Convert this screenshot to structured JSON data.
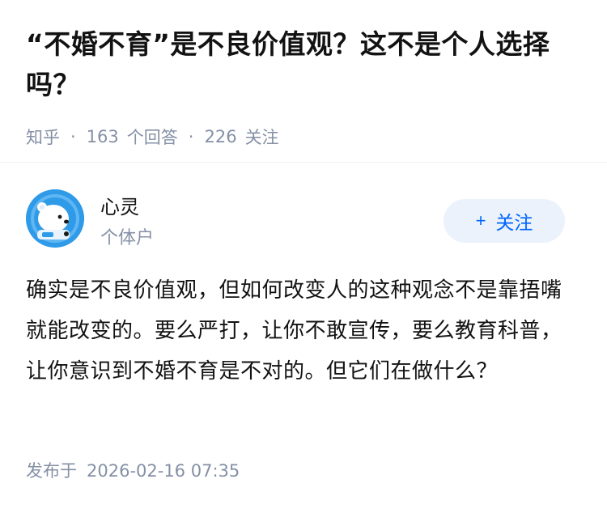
{
  "question": {
    "title": "“不婚不育”是不良价值观？这不是个人选择吗？",
    "source": "知乎",
    "answer_count": "163",
    "answer_label": "个回答",
    "follower_count": "226",
    "follower_label": "关注"
  },
  "author": {
    "name": "心灵",
    "tag": "个体户",
    "avatar_icon": "polar-bear-avatar-icon",
    "follow_label": "关注",
    "follow_icon": "plus-icon"
  },
  "answer": {
    "text": "确实是不良价值观，但如何改变人的这种观念不是靠捂嘴就能改变的。要么严打，让你不敢宣传，要么教育科普，让你意识到不婚不育是不对的。但它们在做什么？",
    "publish_label": "发布于",
    "publish_time": "2026-02-16 07:35"
  },
  "colors": {
    "accent": "#0066ff",
    "muted": "#8590a6",
    "follow_bg": "#ebf2fb"
  }
}
